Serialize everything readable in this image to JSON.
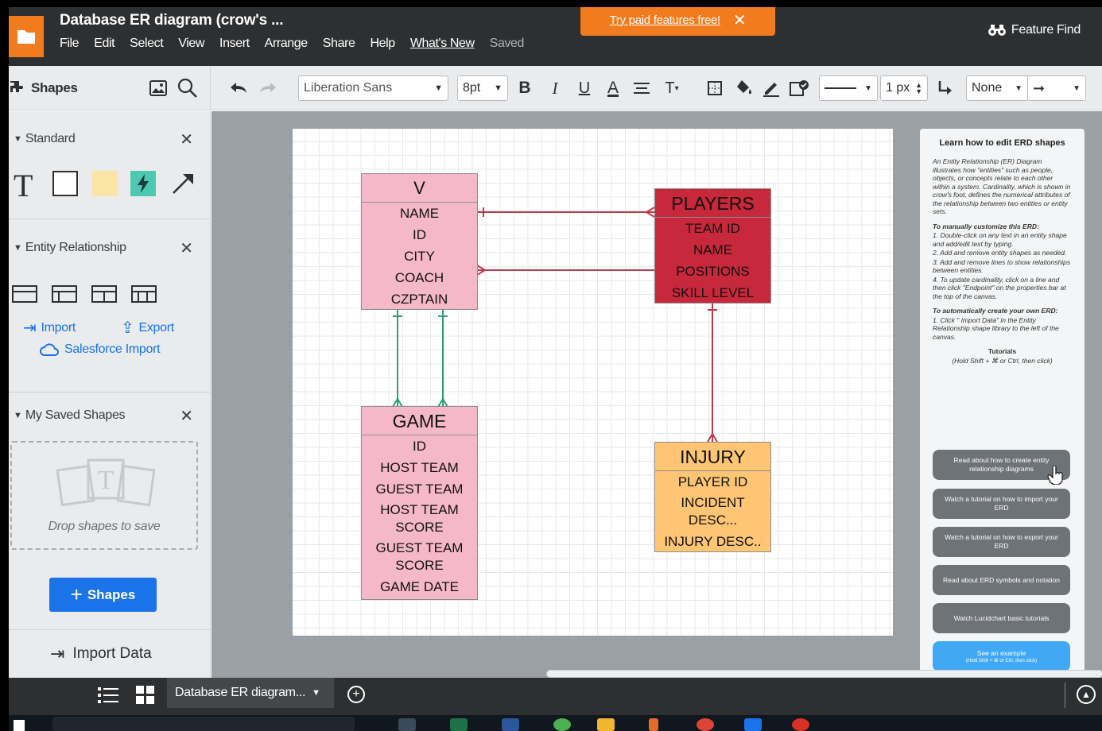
{
  "app": {
    "doc_title": "Database ER diagram (crow's ...",
    "menu": [
      "File",
      "Edit",
      "Select",
      "View",
      "Insert",
      "Arrange",
      "Share",
      "Help"
    ],
    "whats_new": "What's New",
    "saved": "Saved",
    "promo": "Try paid features free!",
    "feature_find": "Feature Find"
  },
  "toolbar": {
    "shapes_label": "Shapes",
    "font": "Liberation Sans",
    "font_size": "8pt",
    "line_width": "1 px",
    "arrow_start": "None"
  },
  "sidebar": {
    "standard_label": "Standard",
    "er_label": "Entity Relationship",
    "import": "Import",
    "export": "Export",
    "salesforce_import": "Salesforce Import",
    "saved_label": "My Saved Shapes",
    "drop_text": "Drop shapes to save",
    "add_shapes": "Shapes",
    "import_data": "Import Data"
  },
  "diagram": {
    "v": {
      "title": "V",
      "fields": [
        "NAME",
        "ID",
        "CITY",
        "COACH",
        "CZPTAIN"
      ]
    },
    "players": {
      "title": "PLAYERS",
      "fields": [
        "TEAM ID",
        "NAME",
        "POSITIONS",
        "SKILL LEVEL"
      ]
    },
    "game": {
      "title": "GAME",
      "fields": [
        "ID",
        "HOST TEAM",
        "GUEST TEAM",
        "HOST TEAM SCORE",
        "GUEST TEAM SCORE",
        "GAME DATE"
      ]
    },
    "injury": {
      "title": "INJURY",
      "fields": [
        "PLAYER ID",
        "INCIDENT DESC...",
        "INJURY DESC.."
      ]
    }
  },
  "learn": {
    "title": "Learn how to edit ERD shapes",
    "intro": "An Entity Relationship (ER) Diagram illustrates how \"entities\" such as people, objects, or concepts relate to each other within a system. Cardinality, which is shown in crow's foot, defines the numerical attributes of the relationship between two entities or entity sets.",
    "manual_title": "To manually customize this ERD:",
    "manual_steps": [
      "1. Double-click on any text in an entity shape and add/edit text by typing.",
      "2. Add and remove entity shapes as needed.",
      "3. Add and remove lines to show relationships between entities.",
      "4. To update cardinality, click on a line and then click \"Endpoint\" on the properties bar at the top of the canvas."
    ],
    "auto_title": "To automatically create your own ERD:",
    "auto_step": "1. Click \" Import Data\" in the Entity Relationship shape library to the left of the canvas.",
    "tutorials_title": "Tutorials",
    "tutorials_hint": "(Hold Shift + ⌘ or Ctrl, then click)",
    "buttons": [
      "Read about how to create entity relationship diagrams",
      "Watch a tutorial on how to import your ERD",
      "Watch a tutorial on how to export your ERD",
      "Read about ERD symbols and notation",
      "Watch Lucidchart basic tutorials"
    ],
    "example": "See an example",
    "example_hint": "(Hold Shift + ⌘ or Ctrl, then click)"
  },
  "bottom": {
    "tab_label": "Database ER diagram..."
  },
  "colors": {
    "topbar": "#2d2f31",
    "accent": "#f27b1e",
    "v_fill": "#f4b8c8",
    "players_fill": "#c8283c",
    "injury_fill": "#fdc574",
    "red_line": "#c0394b",
    "green_line": "#2e9e7a",
    "blue_button": "#1a73e8"
  }
}
